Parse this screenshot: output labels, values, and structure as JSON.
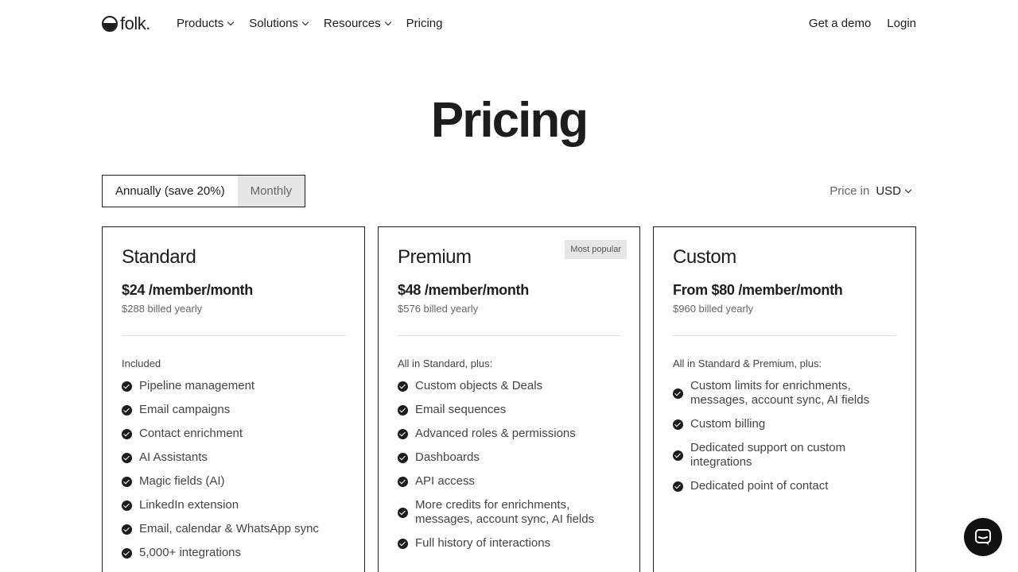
{
  "header": {
    "logo": "folk.",
    "nav": [
      {
        "label": "Products",
        "dropdown": true
      },
      {
        "label": "Solutions",
        "dropdown": true
      },
      {
        "label": "Resources",
        "dropdown": true
      },
      {
        "label": "Pricing",
        "dropdown": false
      }
    ],
    "demo_label": "Get a demo",
    "login_label": "Login"
  },
  "page": {
    "title": "Pricing"
  },
  "billing": {
    "annual_label": "Annually (save 20%)",
    "monthly_label": "Monthly",
    "selected": "annual"
  },
  "currency": {
    "label": "Price in",
    "value": "USD"
  },
  "plans": [
    {
      "name": "Standard",
      "price": "$24 /member/month",
      "billed": "$288 billed yearly",
      "features_head": "Included",
      "features": [
        "Pipeline management",
        "Email campaigns",
        "Contact enrichment",
        "AI Assistants",
        "Magic fields (AI)",
        "LinkedIn extension",
        "Email, calendar & WhatsApp sync",
        "5,000+ integrations"
      ]
    },
    {
      "name": "Premium",
      "badge": "Most popular",
      "price": "$48 /member/month",
      "billed": "$576 billed yearly",
      "features_head": "All in Standard, plus:",
      "features": [
        "Custom objects & Deals",
        "Email sequences",
        "Advanced roles & permissions",
        "Dashboards",
        "API access",
        "More credits for enrichments, messages, account sync, AI fields",
        "Full history of interactions"
      ]
    },
    {
      "name": "Custom",
      "price": "From $80 /member/month",
      "billed": "$960 billed yearly",
      "features_head": "All in Standard & Premium, plus:",
      "features": [
        "Custom limits for enrichments, messages, account sync, AI fields",
        "Custom billing",
        "Dedicated support on custom integrations",
        "Dedicated point of contact"
      ]
    }
  ],
  "icons": {
    "logo": "folk-logo-icon",
    "feature": "check-circle-icon",
    "chat": "chat-icon",
    "dropdown": "chevron-down-icon"
  },
  "colors": {
    "text": "#1d1d1d",
    "muted": "#666666",
    "toggle_inactive_bg": "#e6e6e6",
    "chat_bg": "#111111"
  }
}
